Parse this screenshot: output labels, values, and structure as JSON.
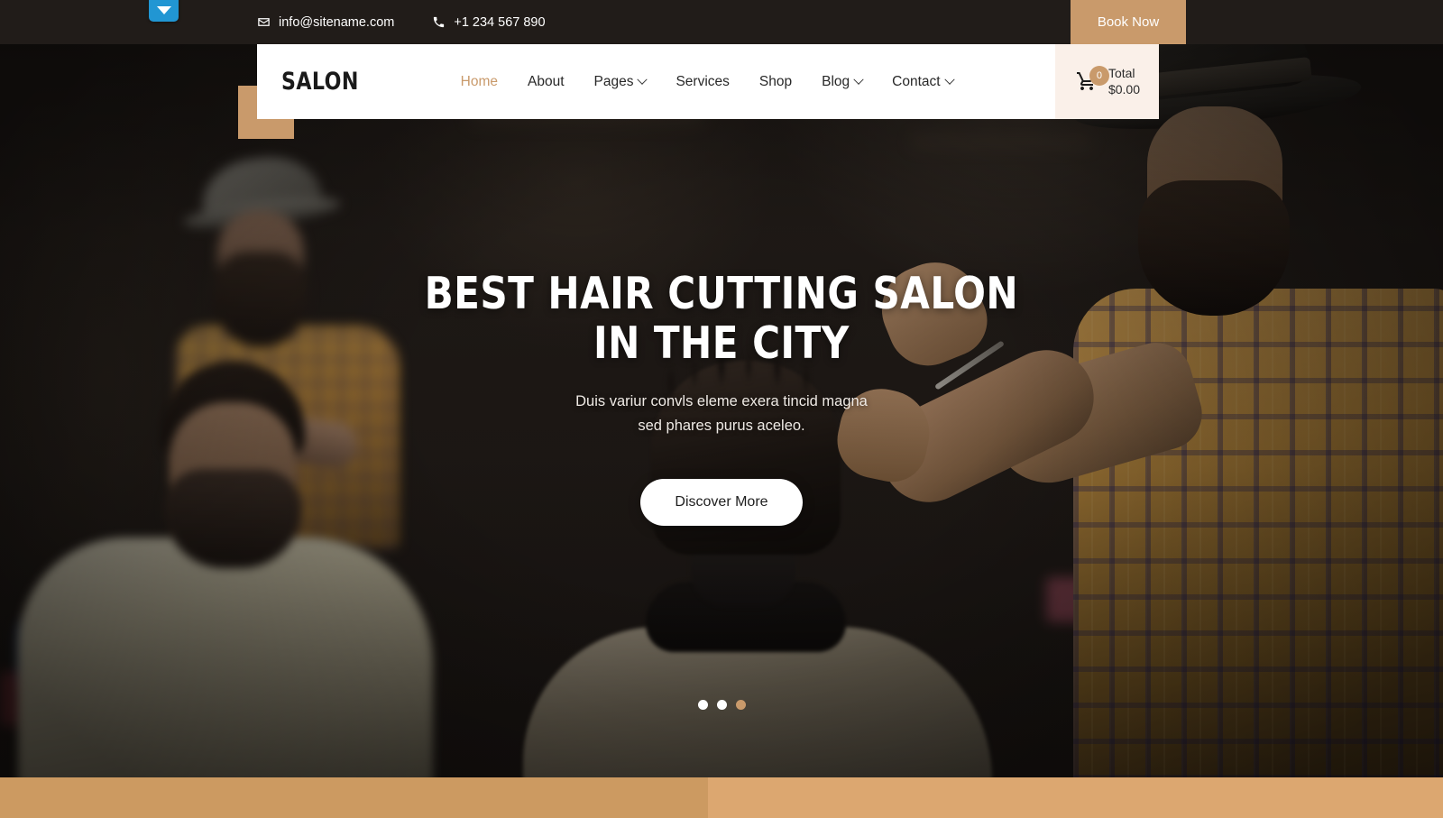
{
  "topbar": {
    "email": "info@sitename.com",
    "email_icon": "envelope-icon",
    "phone": "+1 234 567 890",
    "phone_icon": "phone-icon",
    "book_now_label": "Book Now"
  },
  "widget": {
    "icon": "caret-down-icon",
    "color": "#2196d3"
  },
  "navbar": {
    "logo": "SALON",
    "items": [
      {
        "label": "Home",
        "active": true,
        "dropdown": false
      },
      {
        "label": "About",
        "active": false,
        "dropdown": false
      },
      {
        "label": "Pages",
        "active": false,
        "dropdown": true
      },
      {
        "label": "Services",
        "active": false,
        "dropdown": false
      },
      {
        "label": "Shop",
        "active": false,
        "dropdown": false
      },
      {
        "label": "Blog",
        "active": false,
        "dropdown": true
      },
      {
        "label": "Contact",
        "active": false,
        "dropdown": true
      }
    ],
    "cart": {
      "icon": "shopping-cart-icon",
      "count": "0",
      "total_label": "Total",
      "total_value": "$0.00"
    }
  },
  "hero": {
    "title_line1": "BEST HAIR CUTTING SALON",
    "title_line2": "IN THE CITY",
    "subtitle_line1": "Duis variur convls eleme exera tincid magna",
    "subtitle_line2": "sed phares purus aceleo.",
    "button_label": "Discover More"
  },
  "slider": {
    "dots": [
      {
        "active": false
      },
      {
        "active": false
      },
      {
        "active": true
      }
    ]
  },
  "colors": {
    "accent": "#c99a6b",
    "accent_band_left": "#cc9a61",
    "accent_band_right": "#dca770",
    "cart_bg": "#faf0e9",
    "topbar_bg": "#211c19",
    "nav_bg": "#ffffff",
    "widget_blue": "#2196d3"
  }
}
